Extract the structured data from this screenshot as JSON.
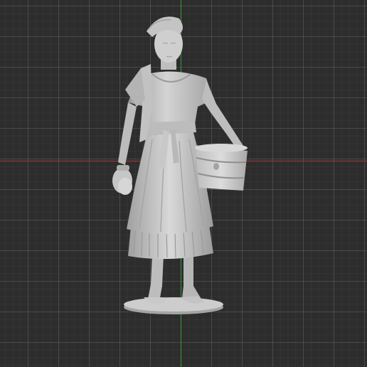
{
  "viewport": {
    "background": "#2d2d2d",
    "grid_color": "#3c3c3c",
    "x_axis_color": "#a33a3a",
    "y_axis_color": "#3a9a3a"
  },
  "model": {
    "subject": "sculpture-figurine",
    "material_color": "#c8c8c8",
    "shadow_color": "#8e8e8e",
    "highlight_color": "#e2e2e2"
  }
}
